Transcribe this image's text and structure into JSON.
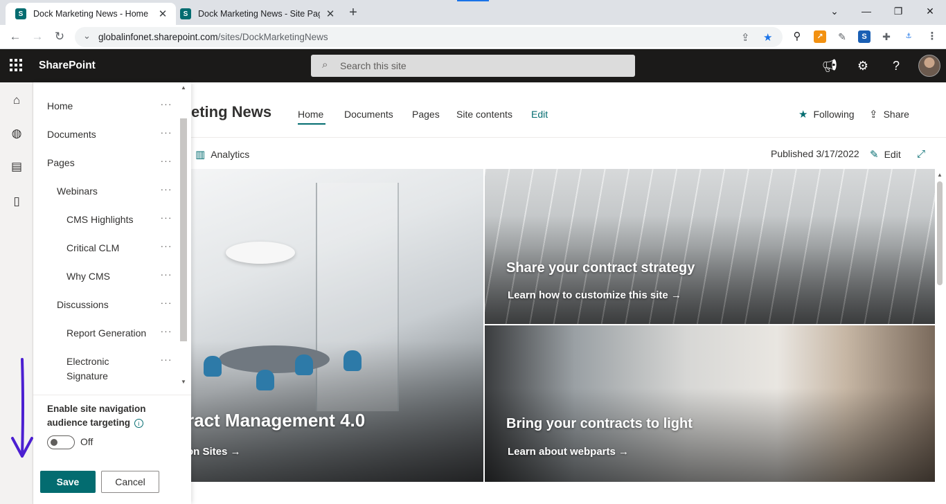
{
  "browser": {
    "tabs": [
      {
        "title": "Dock Marketing News - Home",
        "active": true
      },
      {
        "title": "Dock Marketing News - Site Pages",
        "active": false
      }
    ],
    "url_host": "globalinfonet.sharepoint.com",
    "url_path": "/sites/DockMarketingNews",
    "window_controls": [
      "chevron-down-icon",
      "minimize-icon",
      "restore-icon",
      "close-icon"
    ],
    "extension_icons": [
      "magnifier-icon",
      "chart-extension-icon",
      "pen-extension-icon",
      "s-extension-icon",
      "puzzle-icon",
      "dock-extension-icon",
      "menu-kebab-icon"
    ]
  },
  "suite": {
    "brand": "SharePoint",
    "search_placeholder": "Search this site",
    "icons": [
      "megaphone-icon",
      "settings-gear-icon",
      "help-icon",
      "profile-avatar"
    ]
  },
  "appbar": {
    "icons": [
      "home-icon",
      "globe-icon",
      "news-icon",
      "document-icon"
    ]
  },
  "site": {
    "title": "Dock Marketing News",
    "title_visible": "eting News",
    "topnav": [
      "Home",
      "Documents",
      "Pages",
      "Site contents",
      "Edit"
    ],
    "following_label": "Following",
    "share_label": "Share"
  },
  "commandbar": {
    "analytics_label": "Analytics",
    "published": "Published 3/17/2022",
    "edit_label": "Edit"
  },
  "hero": {
    "main_heading": "ract Management 4.0",
    "main_link": "on Sites",
    "tile_top_heading": "Share your contract strategy",
    "tile_top_link": "Learn how to customize this site",
    "tile_bottom_heading": "Bring your contracts to light",
    "tile_bottom_link": "Learn about webparts"
  },
  "nav_panel": {
    "items": [
      {
        "label": "Home",
        "level": 0
      },
      {
        "label": "Documents",
        "level": 0
      },
      {
        "label": "Pages",
        "level": 0
      },
      {
        "label": "Webinars",
        "level": 1
      },
      {
        "label": "CMS Highlights",
        "level": 2
      },
      {
        "label": "Critical CLM",
        "level": 2
      },
      {
        "label": "Why CMS",
        "level": 2
      },
      {
        "label": "Discussions",
        "level": 1
      },
      {
        "label": "Report Generation",
        "level": 2
      },
      {
        "label": "Electronic Signature",
        "level": 2
      }
    ],
    "more_label": "···",
    "audience_targeting_label": "Enable site navigation audience targeting",
    "toggle_state": "Off",
    "toggle_on": false,
    "save_label": "Save",
    "cancel_label": "Cancel"
  },
  "colors": {
    "theme_accent": "#036c70",
    "suite_bar": "#1b1a19",
    "annotation_arrow": "#4b1fd1"
  }
}
